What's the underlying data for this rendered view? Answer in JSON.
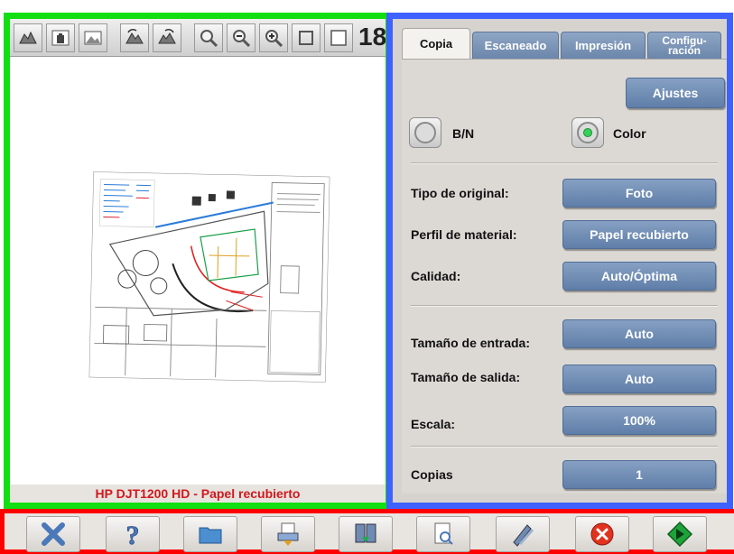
{
  "preview": {
    "zoom_readout": "18",
    "status_text": "HP DJT1200 HD - Papel recubierto",
    "toolbar_icons": [
      "pan-page-icon",
      "hand-pan-icon",
      "image-view-icon",
      "rotate-left-icon",
      "rotate-right-icon",
      "zoom-icon",
      "zoom-out-icon",
      "zoom-in-icon"
    ]
  },
  "settings": {
    "tabs": [
      {
        "label": "Copia",
        "active": true
      },
      {
        "label": "Escaneado",
        "active": false
      },
      {
        "label": "Impresión",
        "active": false
      },
      {
        "label": "Configu-\nración",
        "active": false
      }
    ],
    "ajustes_label": "Ajustes",
    "mode": {
      "bw_label": "B/N",
      "color_label": "Color",
      "selected": "Color"
    },
    "rows": [
      {
        "label": "Tipo de original:",
        "value": "Foto"
      },
      {
        "label": "Perfil de material:",
        "value": "Papel recubierto"
      },
      {
        "label": "Calidad:",
        "value": "Auto/Óptima"
      },
      {
        "label": "Tamaño de entrada:",
        "value": "Auto"
      },
      {
        "label": "Tamaño de salida:",
        "value": "Auto"
      },
      {
        "label": "Escala:",
        "value": "100%"
      },
      {
        "label": "Copias",
        "value": "1"
      }
    ]
  },
  "actions": [
    "close-x-icon",
    "help-icon",
    "folder-icon",
    "scanner-copy-icon",
    "book-copy-icon",
    "print-preview-icon",
    "pens-icon",
    "cancel-icon",
    "start-icon"
  ],
  "colors": {
    "accent_blue": "#6f8bb2",
    "status_red": "#d0181e",
    "panel_bg": "#d6d3cf"
  }
}
